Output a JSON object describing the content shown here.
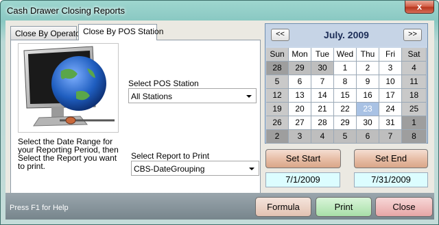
{
  "window": {
    "title": "Cash Drawer Closing Reports",
    "close_glyph": "x"
  },
  "tabs": [
    {
      "label": "Close By Operator",
      "active": false
    },
    {
      "label": "Close By POS Station",
      "active": true
    }
  ],
  "pos": {
    "label": "Select POS Station",
    "value": "All Stations"
  },
  "report": {
    "label": "Select Report to Print",
    "value": "CBS-DateGrouping"
  },
  "help_text": "Select the Date Range for your Reporting Period, then Select the Report you want to print.",
  "calendar": {
    "month": "July. 2009",
    "prev": "<<",
    "next": ">>",
    "days": [
      "Sun",
      "Mon",
      "Tue",
      "Wed",
      "Thu",
      "Fri",
      "Sat"
    ],
    "weeks": [
      [
        "28",
        "29",
        "30",
        "1",
        "2",
        "3",
        "4"
      ],
      [
        "5",
        "6",
        "7",
        "8",
        "9",
        "10",
        "11"
      ],
      [
        "12",
        "13",
        "14",
        "15",
        "16",
        "17",
        "18"
      ],
      [
        "19",
        "20",
        "21",
        "22",
        "23",
        "24",
        "25"
      ],
      [
        "26",
        "27",
        "28",
        "29",
        "30",
        "31",
        "1"
      ],
      [
        "2",
        "3",
        "4",
        "5",
        "6",
        "7",
        "8"
      ]
    ],
    "today": "23"
  },
  "set_start_label": "Set Start",
  "set_end_label": "Set End",
  "start_date": "7/1/2009",
  "end_date": "7/31/2009",
  "status": "Press F1 for Help",
  "buttons": {
    "formula": "Formula",
    "print": "Print",
    "close": "Close"
  }
}
